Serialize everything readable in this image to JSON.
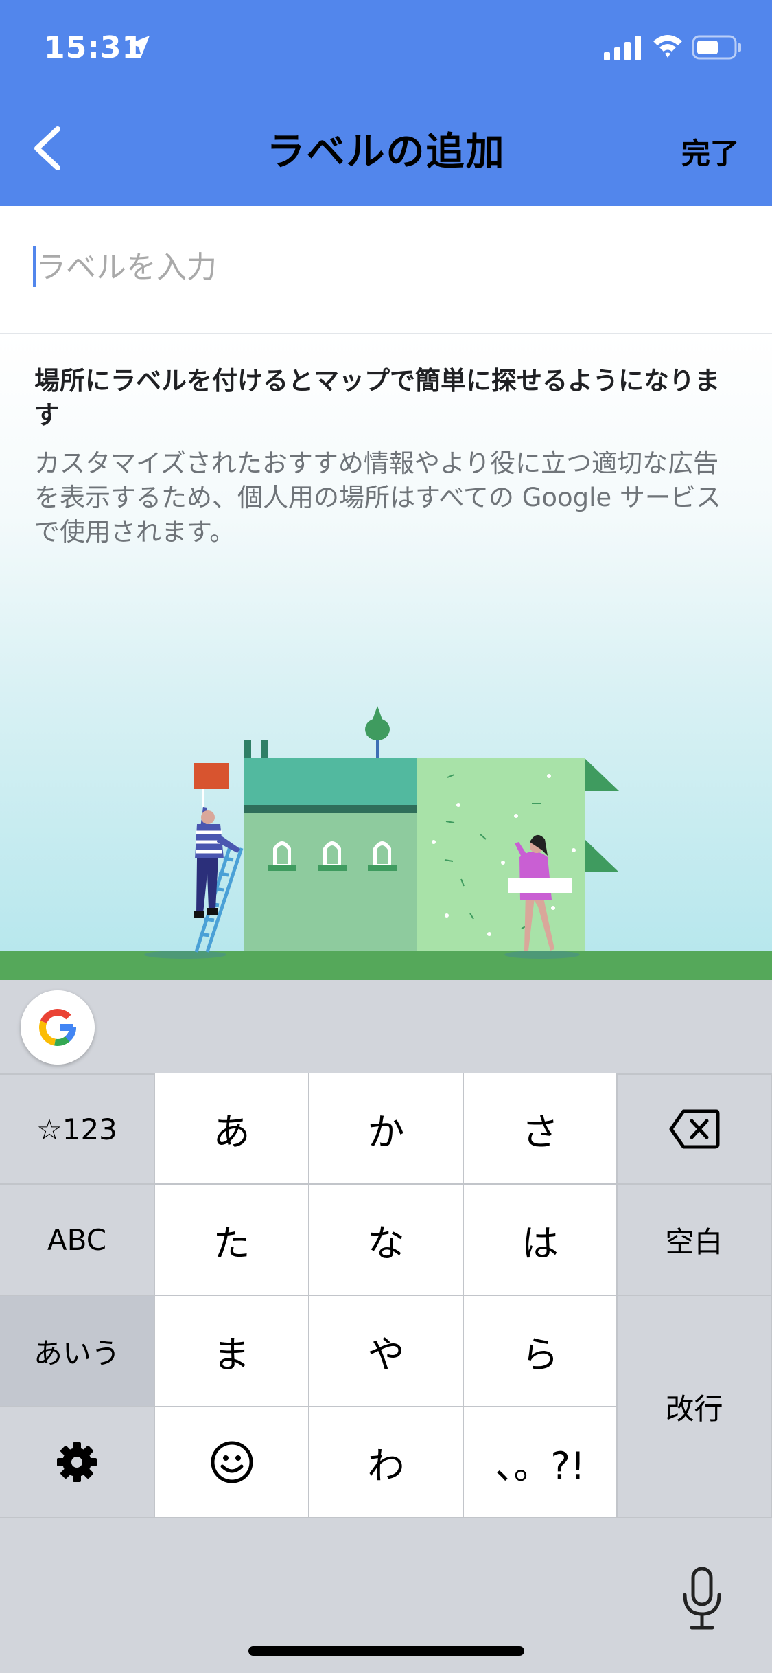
{
  "status_bar": {
    "time": "15:31"
  },
  "nav": {
    "title": "ラベルの追加",
    "done_label": "完了"
  },
  "input": {
    "placeholder": "ラベルを入力",
    "value": ""
  },
  "info": {
    "heading": "場所にラベルを付けるとマップで簡単に探せるようになります",
    "body": "カスタマイズされたおすすめ情報やより役に立つ適切な広告を表示するため、個人用の場所はすべての Google サービスで使用されます。"
  },
  "keyboard": {
    "rows": [
      [
        "☆123",
        "あ",
        "か",
        "さ"
      ],
      [
        "ABC",
        "た",
        "な",
        "は",
        "空白"
      ],
      [
        "あいう",
        "ま",
        "や",
        "ら"
      ],
      [
        "わ",
        "、。?!"
      ]
    ],
    "k_sym": "☆123",
    "k_a": "あ",
    "k_ka": "か",
    "k_sa": "さ",
    "k_abc": "ABC",
    "k_ta": "た",
    "k_na": "な",
    "k_ha": "は",
    "k_space": "空白",
    "k_aiu": "あいう",
    "k_ma": "ま",
    "k_ya": "や",
    "k_ra": "ら",
    "k_enter": "改行",
    "k_wa": "わ",
    "k_punct": "、。?!"
  },
  "colors": {
    "header_blue": "#5286ec",
    "ground_green": "#55a85a",
    "house_teal": "#52b99f"
  },
  "icons": [
    "back-chevron-icon",
    "google-logo-icon",
    "backspace-icon",
    "gear-icon",
    "emoji-icon",
    "microphone-icon"
  ]
}
